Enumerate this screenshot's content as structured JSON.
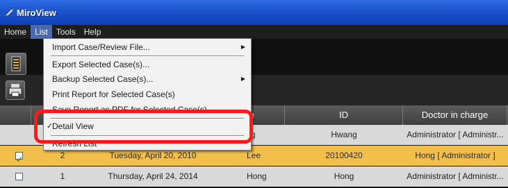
{
  "window": {
    "title": "MiroView",
    "app_icon": "pen-icon"
  },
  "menubar": [
    {
      "label": "Home",
      "active": false
    },
    {
      "label": "List",
      "active": true
    },
    {
      "label": "Tools",
      "active": false
    },
    {
      "label": "Help",
      "active": false
    }
  ],
  "toolbar": {
    "list_icon": "list-view-icon",
    "print_icon": "printer-icon"
  },
  "table": {
    "headers": [
      "",
      "",
      "",
      "me",
      "ID",
      "Doctor in charge"
    ],
    "rows": [
      {
        "checked": false,
        "no": "",
        "date": "",
        "name": "ang",
        "id": "Hwang",
        "doctor": "Administrator [ Administr..."
      },
      {
        "checked": true,
        "no": "2",
        "date": "Tuesday, April 20, 2010",
        "name": "Lee",
        "id": "20100420",
        "doctor": "Hong [ Administrator ]"
      },
      {
        "checked": false,
        "no": "1",
        "date": "Thursday, April 24, 2014",
        "name": "Hong",
        "id": "Hong",
        "doctor": "Administrator [ Administr..."
      }
    ]
  },
  "dropdown": {
    "items": [
      {
        "label": "Import Case/Review File...",
        "submenu": true
      },
      {
        "label": "Export Selected Case(s)...",
        "submenu": false
      },
      {
        "label": "Backup Selected Case(s)...",
        "submenu": true
      },
      {
        "label": "Print Report for Selected Case(s)",
        "submenu": false
      },
      {
        "label": "Save Report as PDF for Selected Case(s)",
        "submenu": false
      },
      {
        "label": "Detail View",
        "checked": true
      },
      {
        "label": "Refresh List",
        "submenu": false
      }
    ]
  },
  "colors": {
    "highlight": "#ff1a1a",
    "selected_row": "#f2c04a",
    "titlebar": "#1c53cc"
  }
}
